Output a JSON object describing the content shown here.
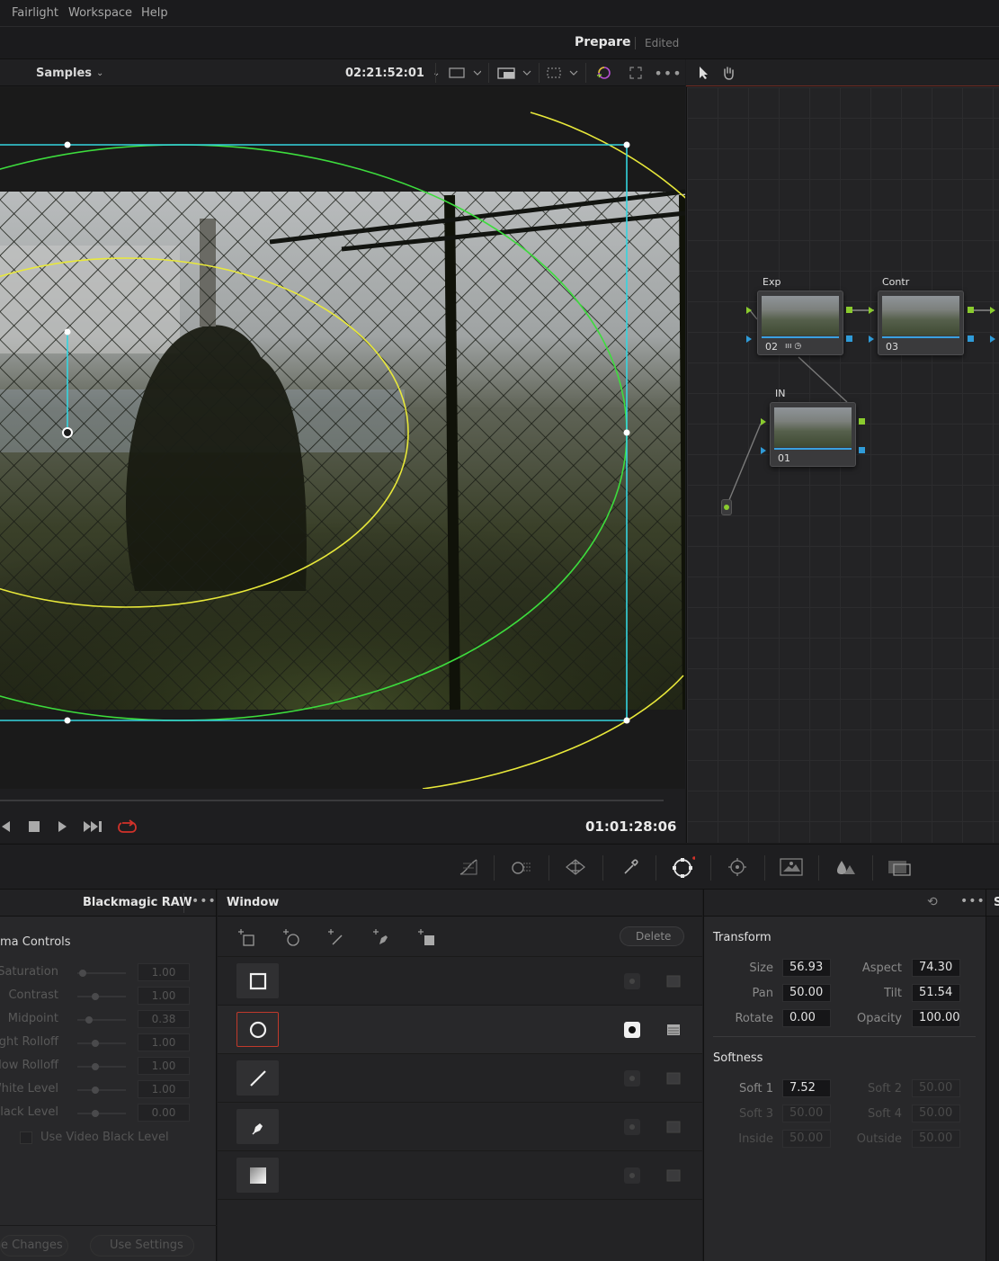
{
  "menu": {
    "items": [
      "Fairlight",
      "Workspace",
      "Help"
    ]
  },
  "title": {
    "project": "Prepare",
    "status": "Edited"
  },
  "viewer_toolbar": {
    "album": "Samples",
    "timecode": "02:21:52:01"
  },
  "transport": {
    "timecode": "01:01:28:06"
  },
  "nodes": [
    {
      "label": "Exp",
      "number": "02"
    },
    {
      "label": "Contr",
      "number": "03"
    },
    {
      "label": "IN",
      "number": "01"
    }
  ],
  "left_panel": {
    "title": "Blackmagic RAW",
    "section": "ma Controls",
    "sliders": [
      {
        "label": "Saturation",
        "value": "1.00"
      },
      {
        "label": "Contrast",
        "value": "1.00"
      },
      {
        "label": "Midpoint",
        "value": "0.38"
      },
      {
        "label": "ight Rolloff",
        "value": "1.00"
      },
      {
        "label": "dow Rolloff",
        "value": "1.00"
      },
      {
        "label": "White Level",
        "value": "1.00"
      },
      {
        "label": "Black Level",
        "value": "0.00"
      }
    ],
    "checkbox_label": "Use Video Black Level",
    "footer_left": "e Changes",
    "footer_right": "Use Settings"
  },
  "window_panel": {
    "title": "Window",
    "delete_label": "Delete"
  },
  "transform": {
    "title": "Transform",
    "size_label": "Size",
    "size": "56.93",
    "aspect_label": "Aspect",
    "aspect": "74.30",
    "pan_label": "Pan",
    "pan": "50.00",
    "tilt_label": "Tilt",
    "tilt": "51.54",
    "rotate_label": "Rotate",
    "rotate": "0.00",
    "opacity_label": "Opacity",
    "opacity": "100.00"
  },
  "softness": {
    "title": "Softness",
    "soft1_label": "Soft 1",
    "soft1": "7.52",
    "soft2_label": "Soft 2",
    "soft2": "50.00",
    "soft3_label": "Soft 3",
    "soft3": "50.00",
    "soft4_label": "Soft 4",
    "soft4": "50.00",
    "inside_label": "Inside",
    "inside": "50.00",
    "outside_label": "Outside",
    "outside": "50.00"
  },
  "right_edge_label": "S",
  "colors": {
    "accent_red": "#c0392b",
    "window_cyan": "#34d5e0",
    "window_green": "#3ddc3d",
    "window_yellow": "#e8e83a",
    "node_link_green": "#8acb2e",
    "node_link_blue": "#2f9bd8"
  }
}
